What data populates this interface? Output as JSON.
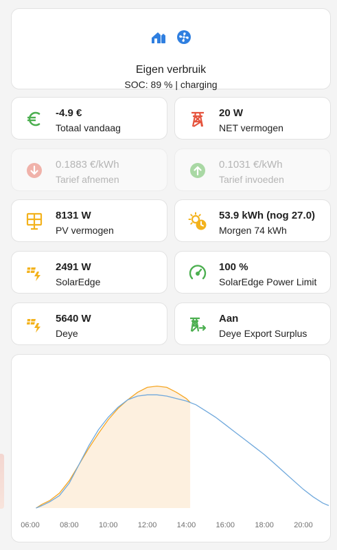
{
  "hero": {
    "title": "Eigen verbruik",
    "subtitle": "SOC: 89 % | charging",
    "icons": [
      "home-battery-icon",
      "fan-icon"
    ],
    "icon_color": "#2f7fe0"
  },
  "tiles": [
    {
      "value": "-4.9 €",
      "label": "Totaal vandaag",
      "icon": "euro-icon",
      "color": "#4caf50"
    },
    {
      "value": "20 W",
      "label": "NET vermogen",
      "icon": "transmission-tower-icon",
      "color": "#e5533d"
    },
    {
      "value": "0.1883 €/kWh",
      "label": "Tarief afnemen",
      "icon": "arrow-down-circle-icon",
      "color": "#f0b2aa"
    },
    {
      "value": "0.1031 €/kWh",
      "label": "Tarief invoeden",
      "icon": "arrow-up-circle-icon",
      "color": "#a9d8a4"
    },
    {
      "value": "8131 W",
      "label": "PV vermogen",
      "icon": "solar-panel-icon",
      "color": "#f3b21c"
    },
    {
      "value": "53.9 kWh (nog 27.0)",
      "label": "Morgen 74 kWh",
      "icon": "weather-sunny-clock-icon",
      "color": "#f3b21c"
    },
    {
      "value": "2491 W",
      "label": "SolarEdge",
      "icon": "solar-power-icon",
      "color": "#f3b21c"
    },
    {
      "value": "100 %",
      "label": "SolarEdge Power Limit",
      "icon": "gauge-icon",
      "color": "#4caf50"
    },
    {
      "value": "5640 W",
      "label": "Deye",
      "icon": "solar-power-icon",
      "color": "#f3b21c"
    },
    {
      "value": "Aan",
      "label": "Deye Export Surplus",
      "icon": "transmission-tower-export-icon",
      "color": "#4caf50"
    }
  ],
  "chart_data": {
    "type": "line",
    "x_ticks": [
      "06:00",
      "08:00",
      "10:00",
      "12:00",
      "14:00",
      "16:00",
      "18:00",
      "20:00"
    ],
    "grid": false,
    "legend": "none",
    "series": [
      {
        "color": "#f5a623",
        "fill": "#fdf0df",
        "points": [
          [
            6.3,
            0
          ],
          [
            6.6,
            3
          ],
          [
            7.0,
            6
          ],
          [
            7.5,
            12
          ],
          [
            8.0,
            22
          ],
          [
            8.5,
            35
          ],
          [
            9.0,
            48
          ],
          [
            9.5,
            60
          ],
          [
            10.0,
            71
          ],
          [
            10.5,
            80
          ],
          [
            11.0,
            87
          ],
          [
            11.5,
            93
          ],
          [
            12.0,
            97
          ],
          [
            12.5,
            98
          ],
          [
            13.0,
            97
          ],
          [
            13.5,
            93
          ],
          [
            14.0,
            88
          ],
          [
            14.2,
            85
          ]
        ]
      },
      {
        "color": "#6fa8dc",
        "points": [
          [
            6.3,
            0
          ],
          [
            6.6,
            2
          ],
          [
            7.0,
            5
          ],
          [
            7.5,
            10
          ],
          [
            8.0,
            20
          ],
          [
            8.5,
            35
          ],
          [
            9.0,
            50
          ],
          [
            9.5,
            63
          ],
          [
            10.0,
            73
          ],
          [
            10.5,
            81
          ],
          [
            11.0,
            87
          ],
          [
            11.5,
            90
          ],
          [
            12.0,
            91
          ],
          [
            12.5,
            91
          ],
          [
            13.0,
            90
          ],
          [
            13.5,
            88
          ],
          [
            14.0,
            86
          ],
          [
            14.5,
            83
          ],
          [
            15.0,
            78
          ],
          [
            15.5,
            73
          ],
          [
            16.0,
            67
          ],
          [
            16.5,
            61
          ],
          [
            17.0,
            55
          ],
          [
            17.5,
            49
          ],
          [
            18.0,
            43
          ],
          [
            18.5,
            36
          ],
          [
            19.0,
            29
          ],
          [
            19.5,
            22
          ],
          [
            20.0,
            15
          ],
          [
            20.5,
            9
          ],
          [
            21.0,
            4
          ],
          [
            21.3,
            2
          ]
        ]
      }
    ]
  }
}
